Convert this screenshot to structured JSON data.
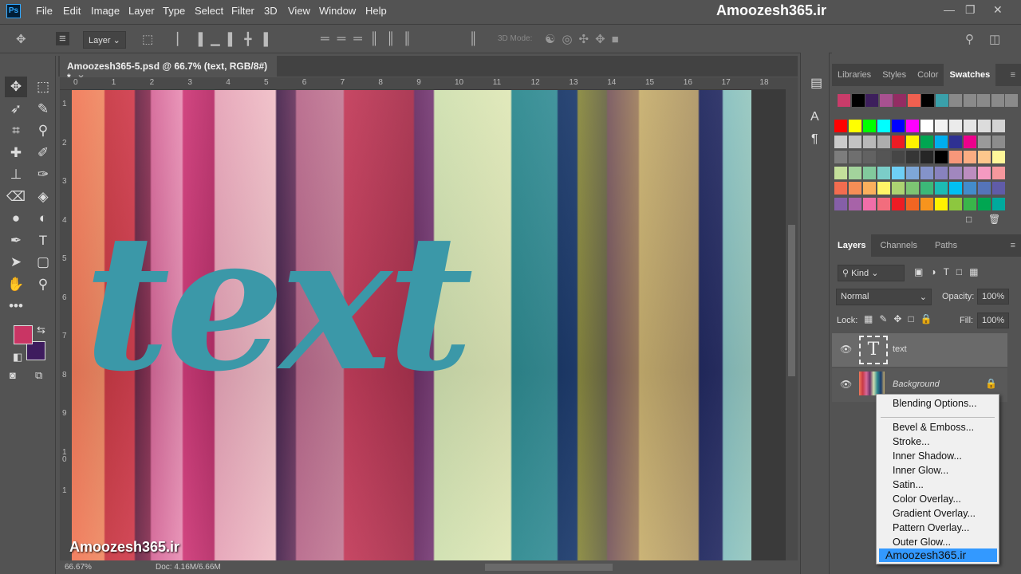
{
  "app": {
    "logo": "Ps",
    "brand": "Amoozesh365.ir"
  },
  "menu": [
    "File",
    "Edit",
    "Image",
    "Layer",
    "Type",
    "Select",
    "Filter",
    "3D",
    "View",
    "Window",
    "Help"
  ],
  "options": {
    "auto_select": "Layer",
    "mode3d": "3D Mode:"
  },
  "document": {
    "tab": "Amoozesh365-5.psd @ 66.7% (text, RGB/8#) *",
    "close": "×",
    "canvas_text": "text",
    "watermark": "Amoozesh365.ir"
  },
  "ruler_top": [
    "0",
    "1",
    "2",
    "3",
    "4",
    "5",
    "6",
    "7",
    "8",
    "9",
    "10",
    "11",
    "12",
    "13",
    "14",
    "15",
    "16",
    "17",
    "18"
  ],
  "ruler_left": [
    "1",
    "2",
    "3",
    "4",
    "5",
    "6",
    "7",
    "8",
    "9",
    "1\n0",
    "1"
  ],
  "status": {
    "zoom": "66.67%",
    "doc": "Doc: 4.16M/6.66M"
  },
  "colors": {
    "foreground": "#c93564",
    "background": "#3e1c5e",
    "text_fill": "#3b98a8"
  },
  "swatches_panel": {
    "tabs": [
      "Libraries",
      "Styles",
      "Color",
      "Swatches"
    ],
    "active": "Swatches",
    "recent": [
      "#c93c6a",
      "#000000",
      "#3d1f5c",
      "#a85190",
      "#942c63",
      "#f06050",
      "#000000",
      "#3aa0aa",
      "#8a8a8a",
      "#8a8a8a",
      "#8a8a8a",
      "#8a8a8a",
      "#8a8a8a"
    ],
    "grid": [
      "#ff0000",
      "#ffff00",
      "#00ff00",
      "#00ffff",
      "#0000ff",
      "#ff00ff",
      "#ffffff",
      "#f2f2f2",
      "#ebebeb",
      "#e5e5e5",
      "#dcdcdc",
      "#d3d3d3",
      "#cbcbcb",
      "#c2c2c2",
      "#b8b8b8",
      "#adadad",
      "#ed1c24",
      "#fff200",
      "#00a651",
      "#00aeef",
      "#2e3192",
      "#ec008c",
      "#9a9a9a",
      "#8c8c8c",
      "#7d7d7d",
      "#6f6f6f",
      "#626262",
      "#555555",
      "#464646",
      "#363636",
      "#262626",
      "#000000",
      "#f7977a",
      "#fbad82",
      "#fdc68c",
      "#fff799",
      "#c4df9b",
      "#a3d39c",
      "#82ca9d",
      "#7bcdc8",
      "#6ecff6",
      "#7ea7d8",
      "#8493ca",
      "#8882be",
      "#a187be",
      "#bc8dbf",
      "#f49ac1",
      "#f5989d",
      "#f26c4f",
      "#f68e56",
      "#fbaf5d",
      "#fff467",
      "#acd372",
      "#7dc473",
      "#3cb878",
      "#1cbbb4",
      "#00bff3",
      "#438ccb",
      "#5574b9",
      "#605ca8",
      "#855fa8",
      "#a763a8",
      "#f06ea9",
      "#f26d7d",
      "#ed1c24",
      "#f26522",
      "#f7941d",
      "#fff200",
      "#8dc73f",
      "#39b54a",
      "#00a651",
      "#00a99d"
    ]
  },
  "layers_panel": {
    "tabs": [
      "Layers",
      "Channels",
      "Paths"
    ],
    "active": "Layers",
    "filter": "Kind",
    "blend": "Normal",
    "opacity_label": "Opacity:",
    "opacity": "100%",
    "lock_label": "Lock:",
    "fill_label": "Fill:",
    "fill": "100%",
    "layers": [
      {
        "name": "text",
        "thumb": "T"
      },
      {
        "name": "Background"
      }
    ]
  },
  "context_menu": {
    "items": [
      "Blending Options...",
      "Bevel & Emboss...",
      "Stroke...",
      "Inner Shadow...",
      "Inner Glow...",
      "Satin...",
      "Color Overlay...",
      "Gradient Overlay...",
      "Pattern Overlay...",
      "Outer Glow..."
    ],
    "highlighted": "Amoozesh365.ir"
  }
}
